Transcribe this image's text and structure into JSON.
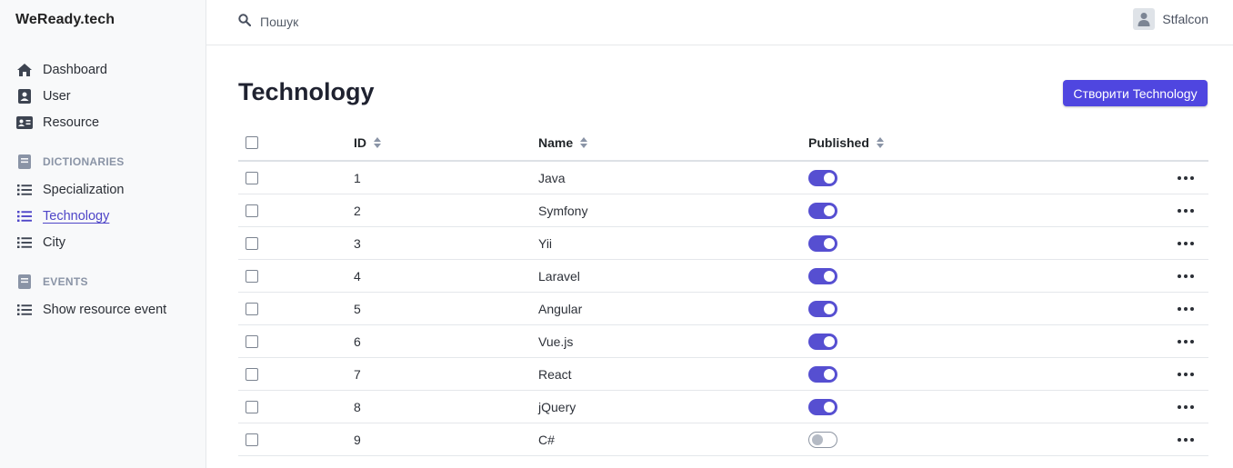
{
  "brand": "WeReady.tech",
  "nav": {
    "dashboard": "Dashboard",
    "user": "User",
    "resource": "Resource",
    "dictionaries": "DICTIONARIES",
    "specialization": "Specialization",
    "technology": "Technology",
    "city": "City",
    "events": "EVENTS",
    "show_resource_event": "Show resource event"
  },
  "search": {
    "placeholder": "Пошук"
  },
  "user": {
    "name": "Stfalcon"
  },
  "page": {
    "title": "Technology",
    "create_label": "Створити Technology"
  },
  "table": {
    "headers": {
      "id": "ID",
      "name": "Name",
      "published": "Published"
    },
    "rows": [
      {
        "id": "1",
        "name": "Java",
        "published": true
      },
      {
        "id": "2",
        "name": "Symfony",
        "published": true
      },
      {
        "id": "3",
        "name": "Yii",
        "published": true
      },
      {
        "id": "4",
        "name": "Laravel",
        "published": true
      },
      {
        "id": "5",
        "name": "Angular",
        "published": true
      },
      {
        "id": "6",
        "name": "Vue.js",
        "published": true
      },
      {
        "id": "7",
        "name": "React",
        "published": true
      },
      {
        "id": "8",
        "name": "jQuery",
        "published": true
      },
      {
        "id": "9",
        "name": "C#",
        "published": false
      }
    ]
  },
  "colors": {
    "accent": "#4f46e0",
    "toggle_on": "#564fd1",
    "active_nav": "#4f46c8",
    "section_label": "#8a94a6"
  },
  "icons": {
    "dashboard": "home-icon",
    "user": "user-badge-icon",
    "resource": "id-card-icon",
    "dictionaries": "book-icon",
    "list": "list-icon",
    "events": "book-icon",
    "search": "search-icon",
    "avatar": "user-avatar-icon",
    "sort": "sort-icon",
    "row_actions": "ellipsis-icon"
  }
}
